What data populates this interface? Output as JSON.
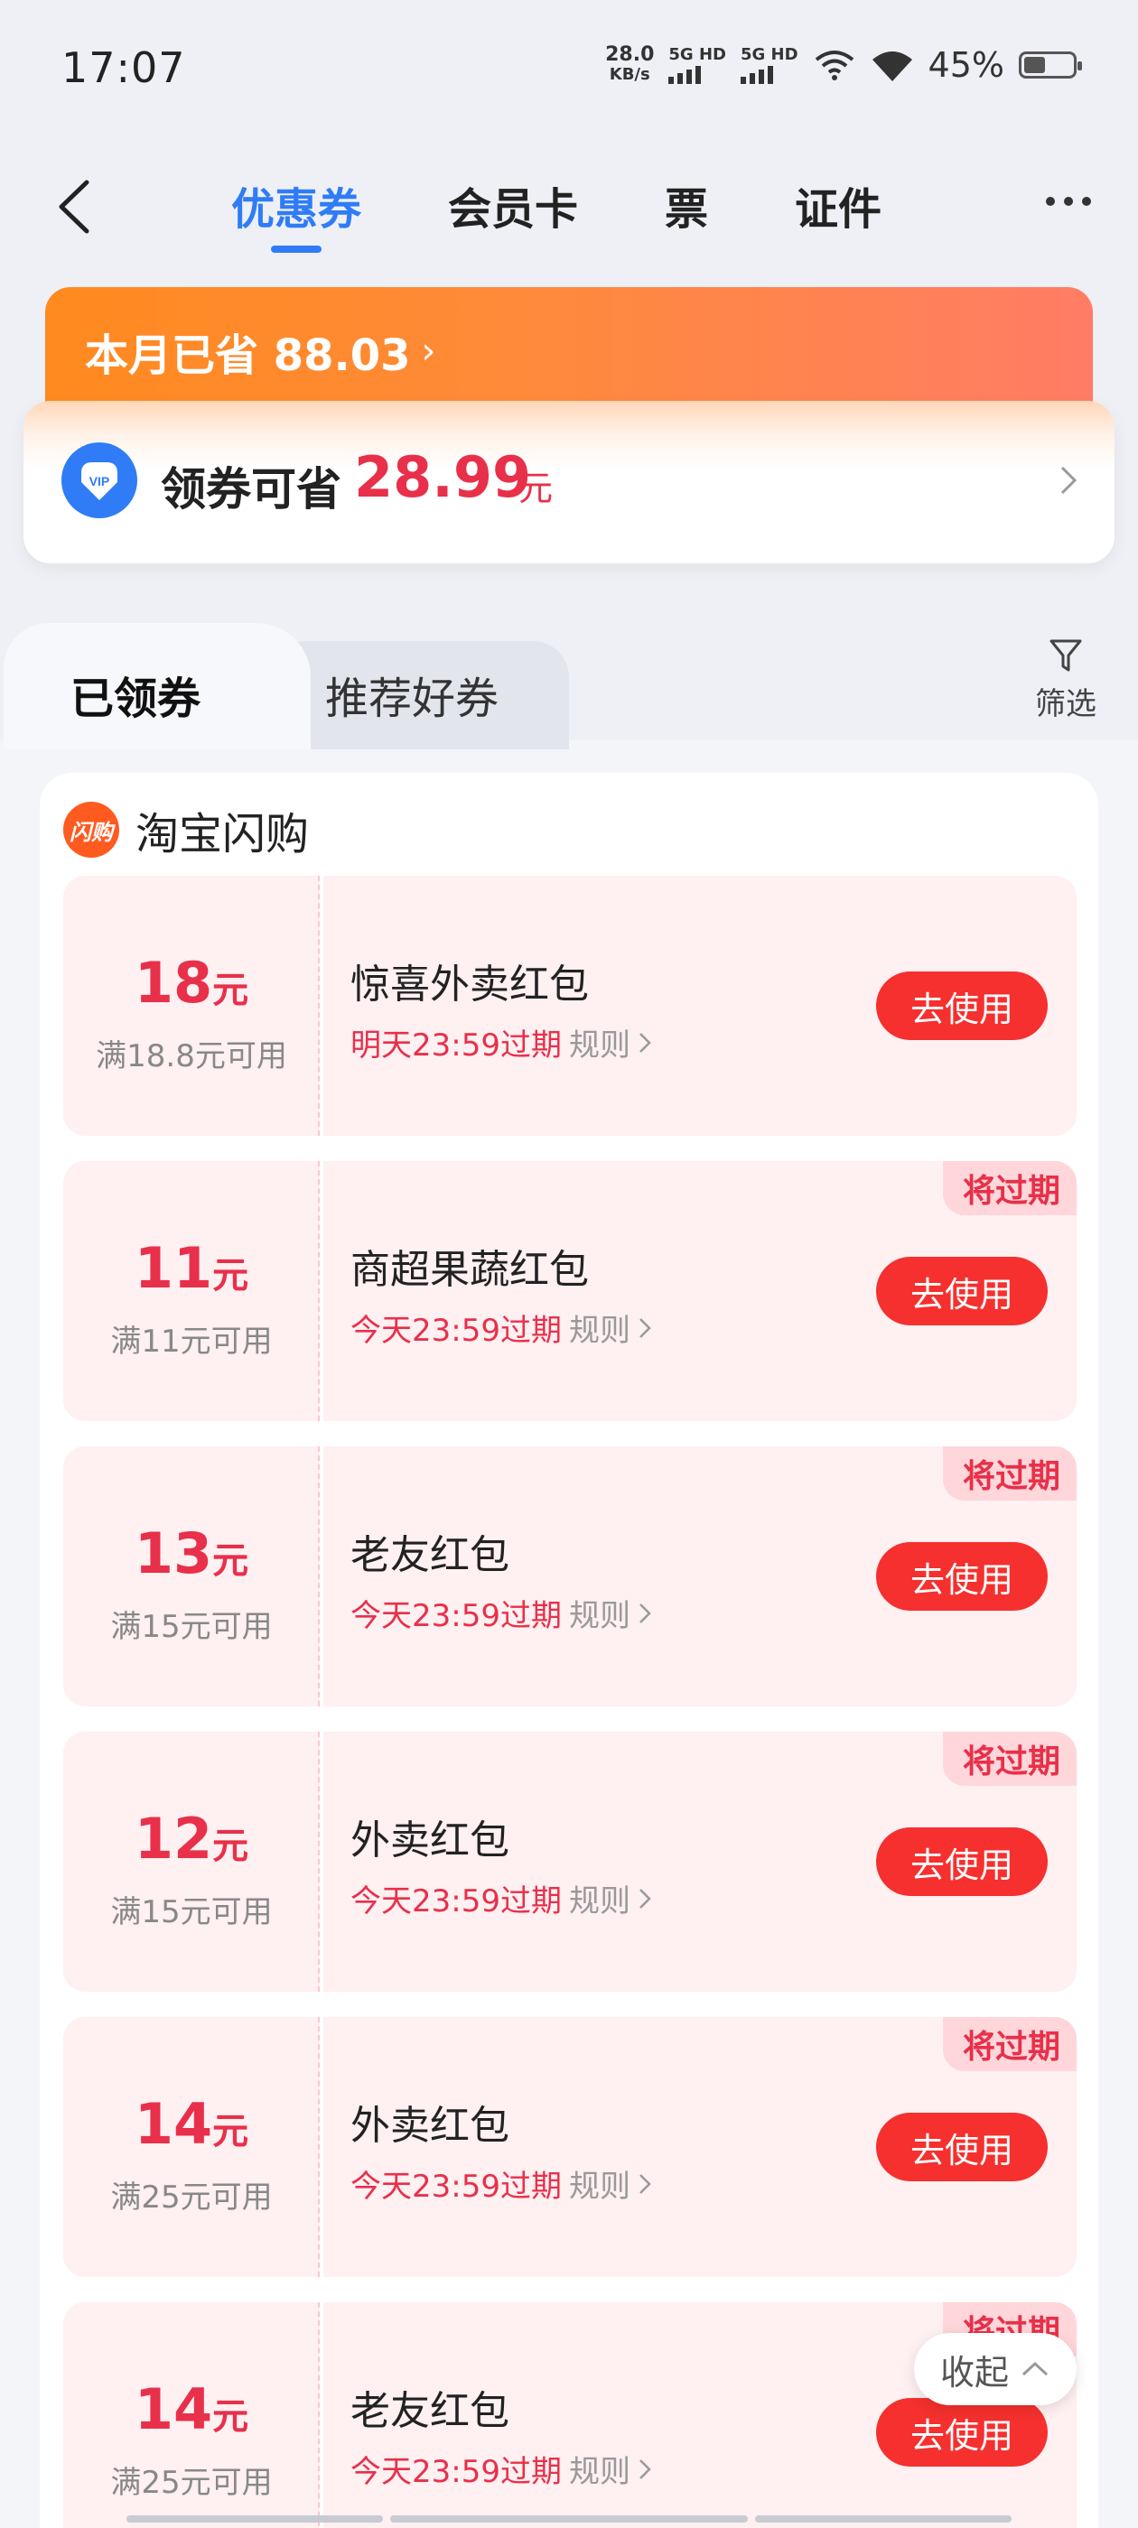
{
  "status": {
    "time": "17:07",
    "net_speed_value": "28.0",
    "net_speed_unit": "KB/s",
    "sim1_label": "5G HD",
    "sim2_label": "5G HD",
    "battery": "45%"
  },
  "nav": {
    "tabs": [
      {
        "label": "优惠券",
        "active": true
      },
      {
        "label": "会员卡",
        "active": false
      },
      {
        "label": "票",
        "active": false
      },
      {
        "label": "证件",
        "active": false
      }
    ]
  },
  "savings": {
    "month_label": "本月已省 88.03",
    "coupon_label": "领券可省",
    "coupon_amount": "28.99",
    "coupon_unit": "元"
  },
  "subtabs": {
    "received": "已领券",
    "recommend": "推荐好券",
    "filter": "筛选"
  },
  "group": {
    "logo_text": "闪购",
    "name": "淘宝闪购"
  },
  "coupons": [
    {
      "amount": "18",
      "unit": "元",
      "condition": "满18.8元可用",
      "title": "惊喜外卖红包",
      "expire": "明天23:59过期",
      "rule": "规则",
      "button": "去使用",
      "tag": ""
    },
    {
      "amount": "11",
      "unit": "元",
      "condition": "满11元可用",
      "title": "商超果蔬红包",
      "expire": "今天23:59过期",
      "rule": "规则",
      "button": "去使用",
      "tag": "将过期"
    },
    {
      "amount": "13",
      "unit": "元",
      "condition": "满15元可用",
      "title": "老友红包",
      "expire": "今天23:59过期",
      "rule": "规则",
      "button": "去使用",
      "tag": "将过期"
    },
    {
      "amount": "12",
      "unit": "元",
      "condition": "满15元可用",
      "title": "外卖红包",
      "expire": "今天23:59过期",
      "rule": "规则",
      "button": "去使用",
      "tag": "将过期"
    },
    {
      "amount": "14",
      "unit": "元",
      "condition": "满25元可用",
      "title": "外卖红包",
      "expire": "今天23:59过期",
      "rule": "规则",
      "button": "去使用",
      "tag": "将过期"
    },
    {
      "amount": "14",
      "unit": "元",
      "condition": "满25元可用",
      "title": "老友红包",
      "expire": "今天23:59过期",
      "rule": "规则",
      "button": "去使用",
      "tag": "将过期"
    }
  ],
  "collapse": "收起",
  "colors": {
    "accent_blue": "#2f7cf6",
    "coupon_red": "#e8304a",
    "button_red": "#f5302e",
    "banner_orange": "#ff8a1f"
  }
}
